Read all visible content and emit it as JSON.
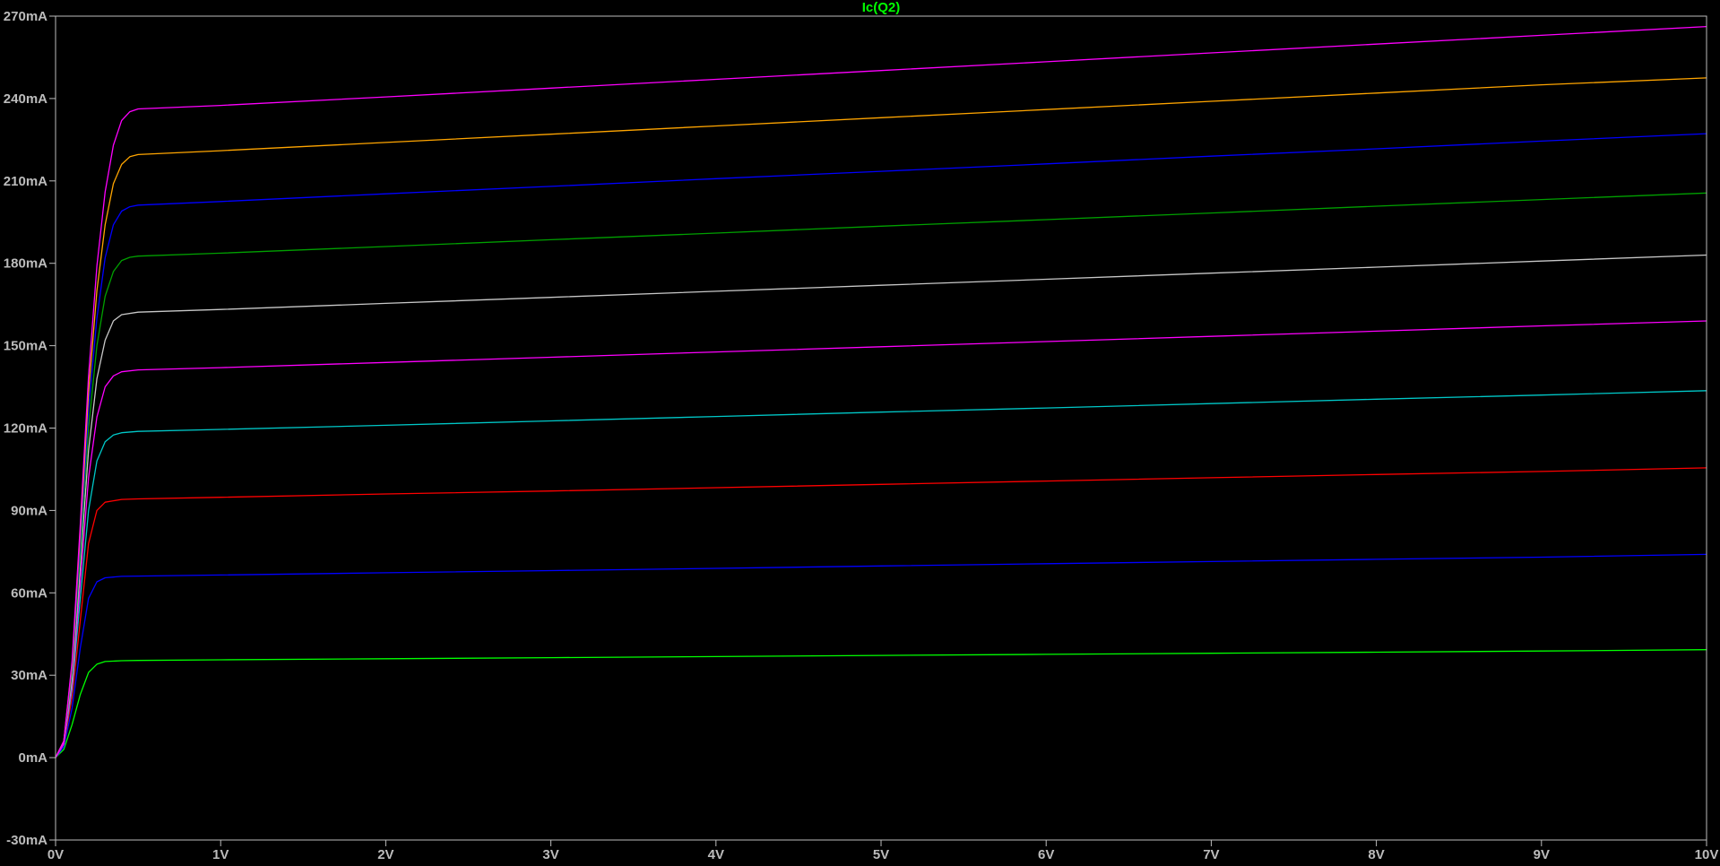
{
  "chart_data": {
    "type": "line",
    "title": "Ic(Q2)",
    "title_color": "#00ff00",
    "background_color": "#000000",
    "axis_color": "#bcbcbc",
    "grid": false,
    "xlabel": "",
    "ylabel": "",
    "xlim": [
      0,
      10
    ],
    "ylim": [
      -30,
      270
    ],
    "x_ticks": [
      {
        "value": 0,
        "label": "0V"
      },
      {
        "value": 1,
        "label": "1V"
      },
      {
        "value": 2,
        "label": "2V"
      },
      {
        "value": 3,
        "label": "3V"
      },
      {
        "value": 4,
        "label": "4V"
      },
      {
        "value": 5,
        "label": "5V"
      },
      {
        "value": 6,
        "label": "6V"
      },
      {
        "value": 7,
        "label": "7V"
      },
      {
        "value": 8,
        "label": "8V"
      },
      {
        "value": 9,
        "label": "9V"
      },
      {
        "value": 10,
        "label": "10V"
      }
    ],
    "y_ticks": [
      {
        "value": 270,
        "label": "270mA"
      },
      {
        "value": 240,
        "label": "240mA"
      },
      {
        "value": 210,
        "label": "210mA"
      },
      {
        "value": 180,
        "label": "180mA"
      },
      {
        "value": 150,
        "label": "150mA"
      },
      {
        "value": 120,
        "label": "120mA"
      },
      {
        "value": 90,
        "label": "90mA"
      },
      {
        "value": 60,
        "label": "60mA"
      },
      {
        "value": 30,
        "label": "30mA"
      },
      {
        "value": 0,
        "label": "0mA"
      },
      {
        "value": -30,
        "label": "-30mA"
      }
    ],
    "series": [
      {
        "color": "#00ff00",
        "values": [
          [
            0,
            0
          ],
          [
            0.05,
            3
          ],
          [
            0.1,
            12
          ],
          [
            0.15,
            23
          ],
          [
            0.2,
            31
          ],
          [
            0.25,
            34
          ],
          [
            0.3,
            35
          ],
          [
            0.4,
            35.3
          ],
          [
            0.5,
            35.4
          ],
          [
            1,
            35.6
          ],
          [
            2,
            36
          ],
          [
            3,
            36.4
          ],
          [
            4,
            36.8
          ],
          [
            5,
            37.2
          ],
          [
            6,
            37.6
          ],
          [
            7,
            38
          ],
          [
            8,
            38.4
          ],
          [
            9,
            38.8
          ],
          [
            10,
            39.3
          ]
        ]
      },
      {
        "color": "#0000ff",
        "values": [
          [
            0,
            0
          ],
          [
            0.05,
            4
          ],
          [
            0.1,
            18
          ],
          [
            0.15,
            40
          ],
          [
            0.2,
            58
          ],
          [
            0.25,
            64
          ],
          [
            0.3,
            65.5
          ],
          [
            0.4,
            66
          ],
          [
            0.5,
            66.1
          ],
          [
            1,
            66.5
          ],
          [
            2,
            67.3
          ],
          [
            3,
            68.1
          ],
          [
            4,
            68.9
          ],
          [
            5,
            69.8
          ],
          [
            6,
            70.6
          ],
          [
            7,
            71.4
          ],
          [
            8,
            72.2
          ],
          [
            9,
            73
          ],
          [
            10,
            74
          ]
        ]
      },
      {
        "color": "#ff0000",
        "values": [
          [
            0,
            0
          ],
          [
            0.05,
            5
          ],
          [
            0.1,
            22
          ],
          [
            0.15,
            50
          ],
          [
            0.2,
            78
          ],
          [
            0.25,
            90
          ],
          [
            0.3,
            93
          ],
          [
            0.4,
            94
          ],
          [
            0.5,
            94.2
          ],
          [
            1,
            94.8
          ],
          [
            2,
            96
          ],
          [
            3,
            97.1
          ],
          [
            4,
            98.3
          ],
          [
            5,
            99.5
          ],
          [
            6,
            100.7
          ],
          [
            7,
            101.9
          ],
          [
            8,
            103.1
          ],
          [
            9,
            104.2
          ],
          [
            10,
            105.5
          ]
        ]
      },
      {
        "color": "#00c8c8",
        "values": [
          [
            0,
            0
          ],
          [
            0.05,
            5
          ],
          [
            0.1,
            25
          ],
          [
            0.15,
            58
          ],
          [
            0.2,
            90
          ],
          [
            0.25,
            108
          ],
          [
            0.3,
            115
          ],
          [
            0.35,
            117.5
          ],
          [
            0.4,
            118.3
          ],
          [
            0.5,
            118.8
          ],
          [
            1,
            119.5
          ],
          [
            2,
            121
          ],
          [
            3,
            122.6
          ],
          [
            4,
            124.2
          ],
          [
            5,
            125.8
          ],
          [
            6,
            127.3
          ],
          [
            7,
            128.9
          ],
          [
            8,
            130.5
          ],
          [
            9,
            132
          ],
          [
            10,
            133.6
          ]
        ]
      },
      {
        "color": "#ff00ff",
        "values": [
          [
            0,
            0
          ],
          [
            0.05,
            5
          ],
          [
            0.1,
            27
          ],
          [
            0.15,
            64
          ],
          [
            0.2,
            102
          ],
          [
            0.25,
            124
          ],
          [
            0.3,
            135
          ],
          [
            0.35,
            139
          ],
          [
            0.4,
            140.5
          ],
          [
            0.5,
            141.2
          ],
          [
            1,
            142
          ],
          [
            2,
            143.9
          ],
          [
            3,
            145.8
          ],
          [
            4,
            147.7
          ],
          [
            5,
            149.6
          ],
          [
            6,
            151.5
          ],
          [
            7,
            153.4
          ],
          [
            8,
            155.3
          ],
          [
            9,
            157.2
          ],
          [
            10,
            159
          ]
        ]
      },
      {
        "color": "#c8c8c8",
        "values": [
          [
            0,
            0
          ],
          [
            0.05,
            6
          ],
          [
            0.1,
            29
          ],
          [
            0.15,
            70
          ],
          [
            0.2,
            112
          ],
          [
            0.25,
            138
          ],
          [
            0.3,
            152
          ],
          [
            0.35,
            159
          ],
          [
            0.4,
            161.3
          ],
          [
            0.5,
            162.2
          ],
          [
            1,
            163.2
          ],
          [
            2,
            165.4
          ],
          [
            3,
            167.6
          ],
          [
            4,
            169.8
          ],
          [
            5,
            172
          ],
          [
            6,
            174.2
          ],
          [
            7,
            176.4
          ],
          [
            8,
            178.6
          ],
          [
            9,
            180.8
          ],
          [
            10,
            183
          ]
        ]
      },
      {
        "color": "#00a000",
        "values": [
          [
            0,
            0
          ],
          [
            0.05,
            6
          ],
          [
            0.1,
            31
          ],
          [
            0.15,
            74
          ],
          [
            0.2,
            120
          ],
          [
            0.25,
            150
          ],
          [
            0.3,
            168
          ],
          [
            0.35,
            177
          ],
          [
            0.4,
            181
          ],
          [
            0.45,
            182.2
          ],
          [
            0.5,
            182.6
          ],
          [
            1,
            183.7
          ],
          [
            2,
            186.1
          ],
          [
            3,
            188.6
          ],
          [
            4,
            191
          ],
          [
            5,
            193.5
          ],
          [
            6,
            195.9
          ],
          [
            7,
            198.3
          ],
          [
            8,
            200.8
          ],
          [
            9,
            203.2
          ],
          [
            10,
            205.6
          ]
        ]
      },
      {
        "color": "#0000ff",
        "values": [
          [
            0,
            0
          ],
          [
            0.05,
            6
          ],
          [
            0.1,
            33
          ],
          [
            0.15,
            78
          ],
          [
            0.2,
            127
          ],
          [
            0.25,
            160
          ],
          [
            0.3,
            182
          ],
          [
            0.35,
            194
          ],
          [
            0.4,
            199
          ],
          [
            0.45,
            200.6
          ],
          [
            0.5,
            201.2
          ],
          [
            1,
            202.5
          ],
          [
            2,
            205.3
          ],
          [
            3,
            208
          ],
          [
            4,
            210.8
          ],
          [
            5,
            213.5
          ],
          [
            6,
            216.2
          ],
          [
            7,
            219
          ],
          [
            8,
            221.7
          ],
          [
            9,
            224.5
          ],
          [
            10,
            227.2
          ]
        ]
      },
      {
        "color": "#ffa500",
        "values": [
          [
            0,
            0
          ],
          [
            0.05,
            6
          ],
          [
            0.1,
            34
          ],
          [
            0.15,
            82
          ],
          [
            0.2,
            133
          ],
          [
            0.25,
            170
          ],
          [
            0.3,
            194
          ],
          [
            0.35,
            209
          ],
          [
            0.4,
            216
          ],
          [
            0.45,
            218.8
          ],
          [
            0.5,
            219.6
          ],
          [
            1,
            221
          ],
          [
            2,
            224
          ],
          [
            3,
            227
          ],
          [
            4,
            230
          ],
          [
            5,
            233
          ],
          [
            6,
            236
          ],
          [
            7,
            239
          ],
          [
            8,
            242
          ],
          [
            9,
            245
          ],
          [
            10,
            247.5
          ]
        ]
      },
      {
        "color": "#ff00ff",
        "values": [
          [
            0,
            0
          ],
          [
            0.05,
            6
          ],
          [
            0.1,
            35
          ],
          [
            0.15,
            85
          ],
          [
            0.2,
            139
          ],
          [
            0.25,
            179
          ],
          [
            0.3,
            206
          ],
          [
            0.35,
            223
          ],
          [
            0.4,
            232
          ],
          [
            0.45,
            235.2
          ],
          [
            0.5,
            236.2
          ],
          [
            1,
            237.5
          ],
          [
            2,
            240.6
          ],
          [
            3,
            243.8
          ],
          [
            4,
            247
          ],
          [
            5,
            250.2
          ],
          [
            6,
            253.4
          ],
          [
            7,
            256.6
          ],
          [
            8,
            259.8
          ],
          [
            9,
            263
          ],
          [
            10,
            266.2
          ]
        ]
      }
    ]
  }
}
